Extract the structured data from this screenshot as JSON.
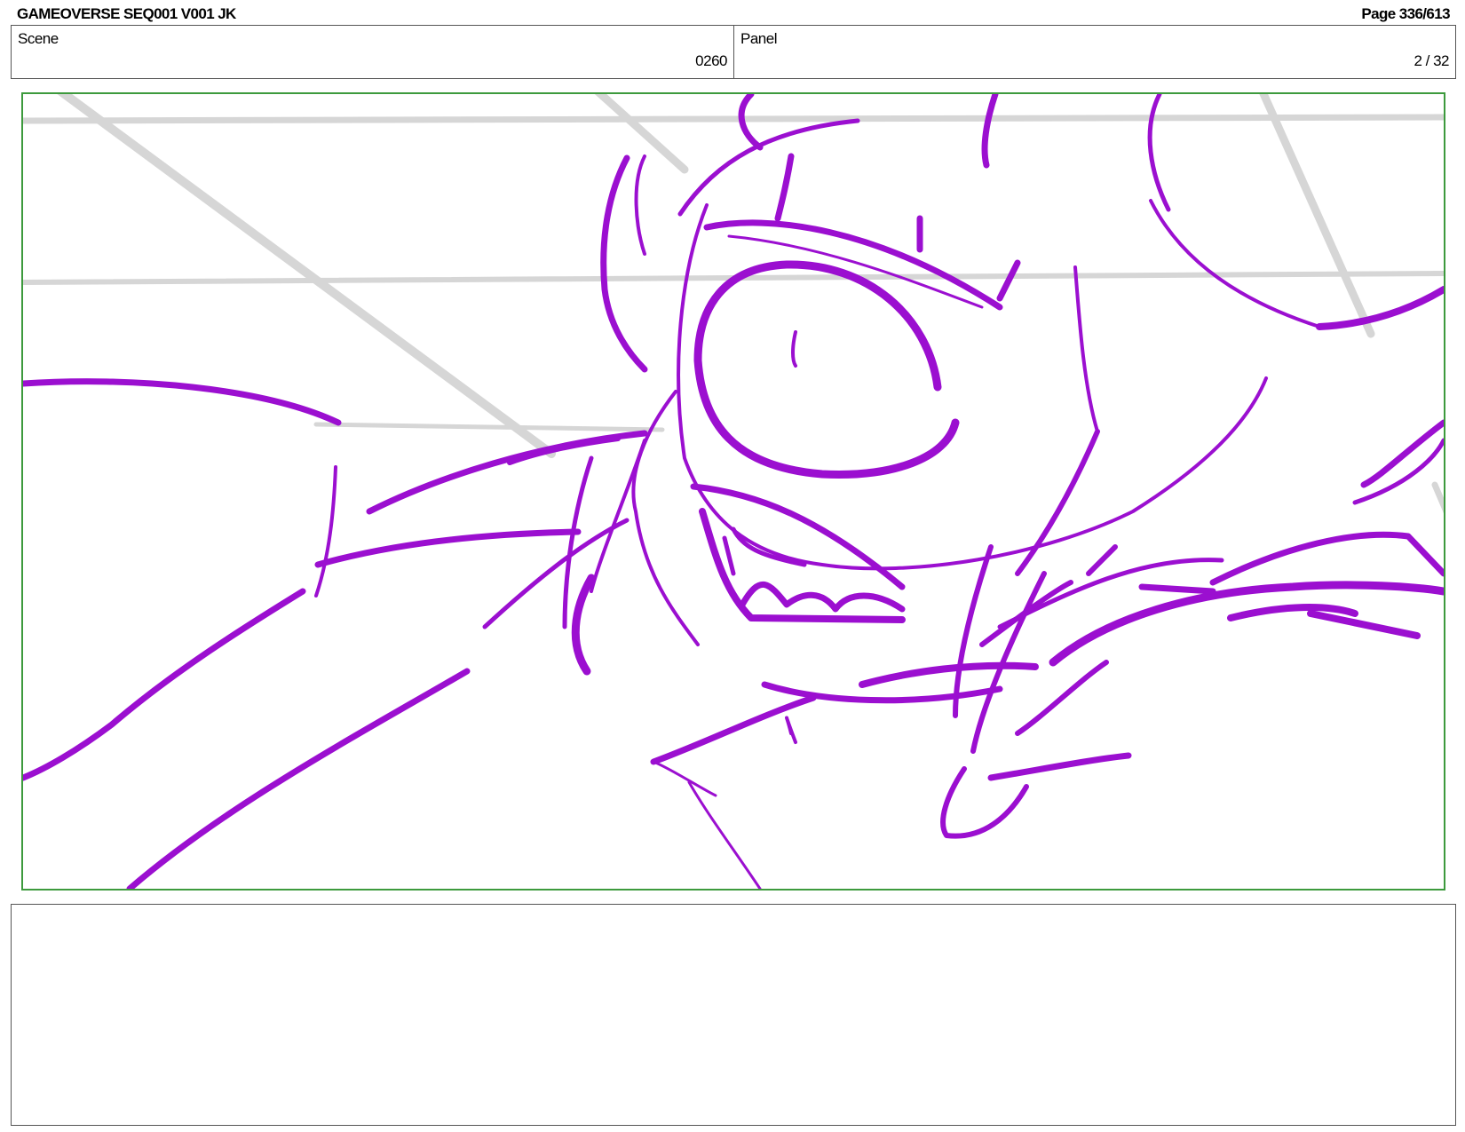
{
  "header": {
    "title": "GAMEOVERSE SEQ001 V001 JK",
    "page": "Page 336/613"
  },
  "info": {
    "scene_label": "Scene",
    "scene_value": "0260",
    "panel_label": "Panel",
    "panel_value": "2 / 32"
  },
  "sketch": {
    "line_color": "#9b0fd0",
    "guide_color": "#d6d6d6",
    "frame_color": "#3d9a3d"
  },
  "notes": {
    "text": ""
  }
}
